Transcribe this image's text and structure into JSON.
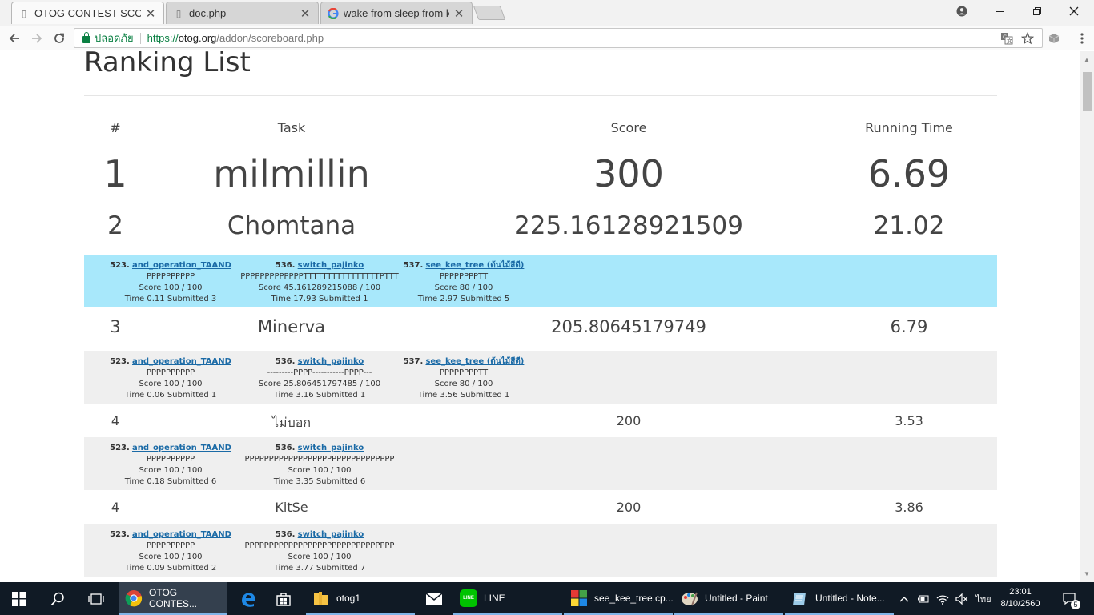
{
  "browser": {
    "tabs": [
      {
        "title": "OTOG CONTEST SCOREB",
        "icon": "page-icon",
        "active": true
      },
      {
        "title": "doc.php",
        "icon": "page-icon",
        "active": false
      },
      {
        "title": "wake from sleep from ke",
        "icon": "google-icon",
        "active": false
      }
    ],
    "close_glyph": "✕",
    "security_label": "ปลอดภัย",
    "url_scheme": "https://",
    "url_host": "otog.org",
    "url_path": "/addon/scoreboard.php"
  },
  "page": {
    "title": "Ranking List",
    "headers": {
      "rank": "#",
      "name": "Task",
      "score": "Score",
      "time": "Running Time"
    },
    "rows": [
      {
        "rank": "1",
        "name": "milmillin",
        "score": "300",
        "time": "6.69"
      },
      {
        "rank": "2",
        "name": "Chomtana",
        "score": "225.16128921509",
        "time": "21.02"
      },
      {
        "rank": "3",
        "name": "Minerva",
        "score": "205.80645179749",
        "time": "6.79"
      },
      {
        "rank": "4",
        "name": "ไม่บอก",
        "score": "200",
        "time": "3.53"
      },
      {
        "rank": "4",
        "name": "KitSe",
        "score": "200",
        "time": "3.86"
      }
    ],
    "details": [
      {
        "tasks": [
          {
            "id": "523.",
            "name": "and_operation_TAAND",
            "result": "PPPPPPPPPP",
            "score": "Score 100 / 100",
            "time": "Time 0.11 Submitted 3"
          },
          {
            "id": "536.",
            "name": "switch_pajinko",
            "result": "PPPPPPPPPPPPPTTTTTTTTTTTTTTTTPTTT",
            "score": "Score 45.161289215088 / 100",
            "time": "Time 17.93 Submitted 1"
          },
          {
            "id": "537.",
            "name": "see_kee_tree (ต้นไม้สีดี)",
            "result": "PPPPPPPPTT",
            "score": "Score 80 / 100",
            "time": "Time 2.97 Submitted 5"
          }
        ]
      },
      {
        "tasks": [
          {
            "id": "523.",
            "name": "and_operation_TAAND",
            "result": "PPPPPPPPPP",
            "score": "Score 100 / 100",
            "time": "Time 0.06 Submitted 1"
          },
          {
            "id": "536.",
            "name": "switch_pajinko",
            "result": "---------PPPP-----------PPPP---",
            "score": "Score 25.806451797485 / 100",
            "time": "Time 3.16 Submitted 1"
          },
          {
            "id": "537.",
            "name": "see_kee_tree (ต้นไม้สีดี)",
            "result": "PPPPPPPPTT",
            "score": "Score 80 / 100",
            "time": "Time 3.56 Submitted 1"
          }
        ]
      },
      {
        "tasks": [
          {
            "id": "523.",
            "name": "and_operation_TAAND",
            "result": "PPPPPPPPPP",
            "score": "Score 100 / 100",
            "time": "Time 0.18 Submitted 6"
          },
          {
            "id": "536.",
            "name": "switch_pajinko",
            "result": "PPPPPPPPPPPPPPPPPPPPPPPPPPPPPPP",
            "score": "Score 100 / 100",
            "time": "Time 3.35 Submitted 6"
          }
        ]
      },
      {
        "tasks": [
          {
            "id": "523.",
            "name": "and_operation_TAAND",
            "result": "PPPPPPPPPP",
            "score": "Score 100 / 100",
            "time": "Time 0.09 Submitted 2"
          },
          {
            "id": "536.",
            "name": "switch_pajinko",
            "result": "PPPPPPPPPPPPPPPPPPPPPPPPPPPPPPP",
            "score": "Score 100 / 100",
            "time": "Time 3.77 Submitted 7"
          }
        ]
      }
    ],
    "highlight_color": "#a8e8fb",
    "detail_bg_color": "#efefef"
  },
  "taskbar": {
    "apps": [
      {
        "label": "OTOG CONTES...",
        "icon": "chrome-icon"
      },
      {
        "label": "otog1",
        "icon": "folder-icon"
      },
      {
        "label": "LINE",
        "icon": "line-icon"
      },
      {
        "label": "see_kee_tree.cp...",
        "icon": "codeblocks-icon"
      },
      {
        "label": "Untitled - Paint",
        "icon": "paint-icon"
      },
      {
        "label": "Untitled - Note...",
        "icon": "notepad-icon"
      }
    ],
    "line_badge": "LINE",
    "language": "ไทย",
    "time": "23:01",
    "date": "8/10/2560",
    "notifications": "5"
  }
}
